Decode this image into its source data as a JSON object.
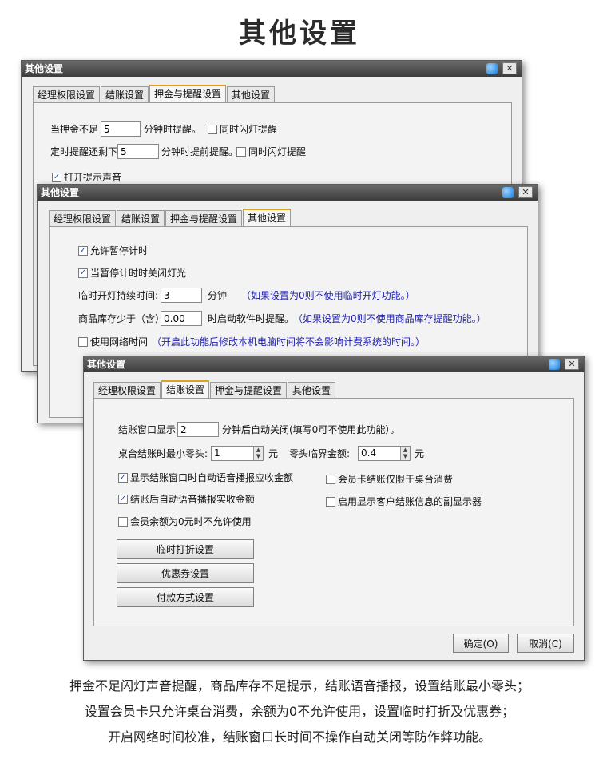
{
  "page_title": "其他设置",
  "window_title": "其他设置",
  "tabs": [
    "经理权限设置",
    "结账设置",
    "押金与提醒设置",
    "其他设置"
  ],
  "win1": {
    "deposit_label": "当押金不足",
    "deposit_value": "5",
    "deposit_suffix": "分钟时提醒。",
    "deposit_flash": "同时闪灯提醒",
    "timer_label": "定时提醒还剩下",
    "timer_value": "5",
    "timer_suffix": "分钟时提前提醒。",
    "timer_flash": "同时闪灯提醒",
    "sound": "打开提示声音"
  },
  "win2": {
    "allow_pause": "允许暂停计时",
    "pause_light": "当暂停计时时关闭灯光",
    "light_label": "临时开灯持续时间:",
    "light_value": "3",
    "light_unit": "分钟",
    "light_hint": "（如果设置为0则不使用临时开灯功能。）",
    "stock_label": "商品库存少于（含）",
    "stock_value": "0.00",
    "stock_suffix": "时启动软件时提醒。",
    "stock_hint": "（如果设置为0则不使用商品库存提醒功能。）",
    "net_time": "使用网络时间",
    "net_hint": "（开启此功能后修改本机电脑时间将不会影响计费系统的时间。）"
  },
  "win3": {
    "checkout_label": "结账窗口显示",
    "checkout_value": "2",
    "checkout_suffix": "分钟后自动关闭(填写0可不使用此功能）。",
    "min_change_label": "桌台结账时最小零头:",
    "min_change_value": "1",
    "min_change_unit": "元",
    "change_threshold_label": "零头临界金额:",
    "change_threshold_value": "0.4",
    "change_threshold_unit": "元",
    "voice_amount": "显示结账窗口时自动语音播报应收金额",
    "voice_paid": "结账后自动语音播报实收金额",
    "zero_balance": "会员余额为0元时不允许使用",
    "member_table_only": "会员卡结账仅限于桌台消费",
    "second_display": "启用显示客户结账信息的副显示器",
    "discount_btn": "临时打折设置",
    "coupon_btn": "优惠券设置",
    "payment_btn": "付款方式设置",
    "ok_btn": "确定(O)",
    "cancel_btn": "取消(C)"
  },
  "captions": [
    "押金不足闪灯声音提醒，商品库存不足提示，结账语音播报，设置结账最小零头；",
    "设置会员卡只允许桌台消费，余额为0不允许使用，设置临时打折及优惠券；",
    "开启网络时间校准，结账窗口长时间不操作自动关闭等防作弊功能。"
  ],
  "icons": {
    "title_gem": "gem-icon",
    "close": "close-icon",
    "check": "✓",
    "spin_up": "▲",
    "spin_down": "▼"
  },
  "checked": {
    "sound": true,
    "allow_pause": true,
    "pause_light": true,
    "net_time": false,
    "voice_amount": true,
    "voice_paid": true,
    "zero_balance": false,
    "member_table_only": false,
    "second_display": false,
    "deposit_flash": false,
    "timer_flash": false
  }
}
